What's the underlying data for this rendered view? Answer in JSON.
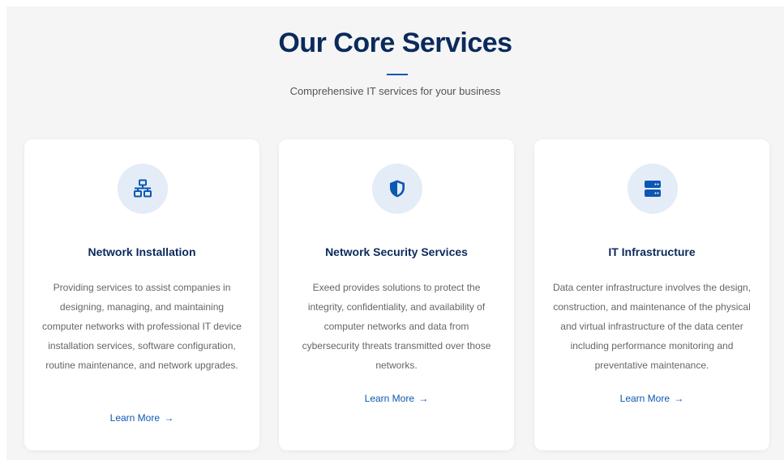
{
  "header": {
    "title": "Our Core Services",
    "subtitle": "Comprehensive IT services for your business"
  },
  "colors": {
    "heading": "#0b2a5c",
    "accent": "#0b57b3",
    "icon_bg": "#e3ecf7",
    "section_bg": "#f5f5f5"
  },
  "services": [
    {
      "icon": "network-icon",
      "title": "Network Installation",
      "description": "Providing services to assist companies in designing, managing, and maintaining computer networks with professional IT device installation services, software configuration, routine maintenance, and network upgrades.",
      "link_label": "Learn More",
      "link_arrow": "→"
    },
    {
      "icon": "shield-icon",
      "title": "Network Security Services",
      "description": "Exeed provides solutions to protect the integrity, confidentiality, and availability of computer networks and data from cybersecurity threats transmitted over those networks.",
      "link_label": "Learn More",
      "link_arrow": "→"
    },
    {
      "icon": "server-icon",
      "title": "IT Infrastructure",
      "description": "Data center infrastructure involves the design, construction, and maintenance of the physical and virtual infrastructure of the data center including performance monitoring and preventative maintenance.",
      "link_label": "Learn More",
      "link_arrow": "→"
    }
  ]
}
